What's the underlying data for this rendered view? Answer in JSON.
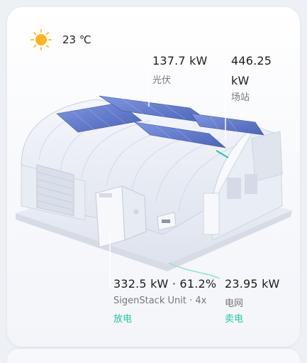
{
  "weather": {
    "temperature": "23 ℃",
    "icon": "sun-icon"
  },
  "solar": {
    "value": "137.7 kW",
    "label": "光伏"
  },
  "site": {
    "value_line1": "446.25",
    "value_line2": "kW",
    "label": "场站"
  },
  "battery": {
    "value": "332.5 kW · 61.2%",
    "label": "SigenStack Unit · 4x",
    "status": "放电",
    "status_color": "#1ec7a8"
  },
  "grid": {
    "value": "23.95 kW",
    "label": "电网",
    "status": "卖电",
    "status_color": "#1ec7a8"
  },
  "colors": {
    "accent": "#1ec7a8",
    "panel": "#5b74c7"
  }
}
